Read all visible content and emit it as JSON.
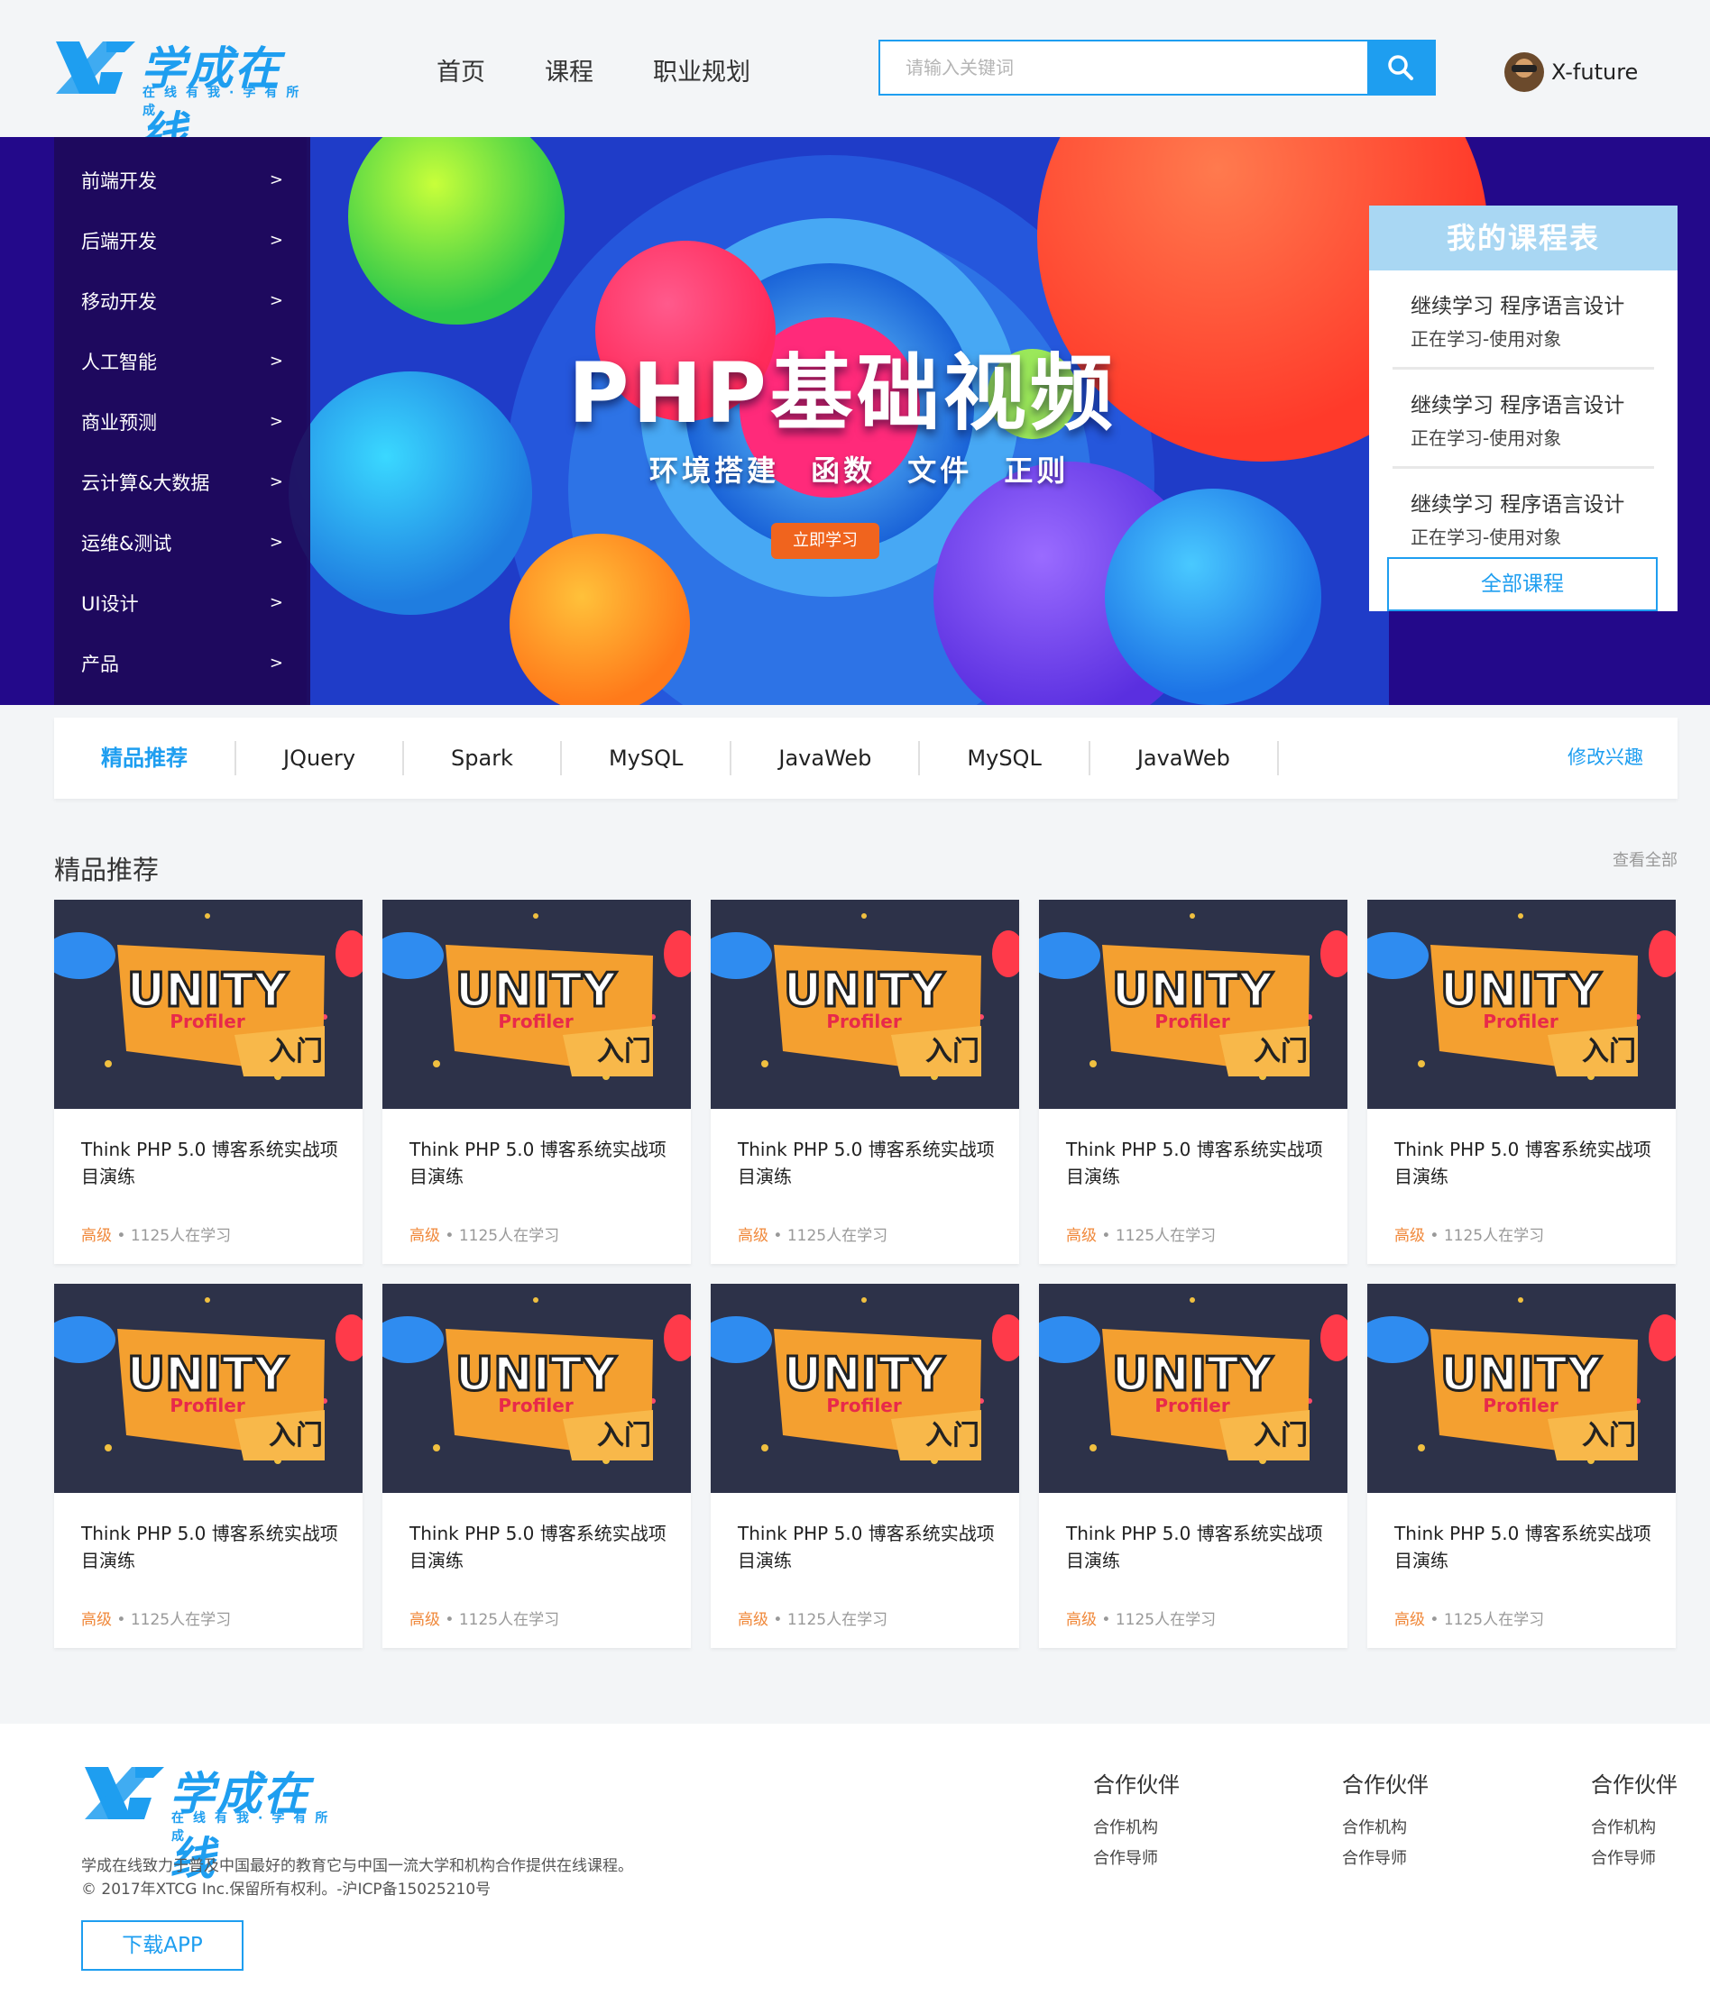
{
  "header": {
    "logo_text": "学成在线",
    "logo_sub": "在线有我·学有所成",
    "nav": [
      "首页",
      "课程",
      "职业规划"
    ],
    "search_placeholder": "请输入关键词",
    "user_name": "X-future"
  },
  "banner": {
    "title": "PHP基础视频",
    "subtitle": "环境搭建 函数 文件 正则",
    "button": "立即学习"
  },
  "categories": [
    {
      "label": "前端开发",
      "arrow": ">"
    },
    {
      "label": "后端开发",
      "arrow": ">"
    },
    {
      "label": "移动开发",
      "arrow": ">"
    },
    {
      "label": "人工智能",
      "arrow": ">"
    },
    {
      "label": "商业预测",
      "arrow": ">"
    },
    {
      "label": "云计算&大数据",
      "arrow": ">"
    },
    {
      "label": "运维&测试",
      "arrow": ">"
    },
    {
      "label": "UI设计",
      "arrow": ">"
    },
    {
      "label": "产品",
      "arrow": ">"
    }
  ],
  "schedule": {
    "title": "我的课程表",
    "items": [
      {
        "course": "继续学习 程序语言设计",
        "status": "正在学习-使用对象"
      },
      {
        "course": "继续学习 程序语言设计",
        "status": "正在学习-使用对象"
      },
      {
        "course": "继续学习 程序语言设计",
        "status": "正在学习-使用对象"
      }
    ],
    "all_button": "全部课程"
  },
  "tabs": {
    "items": [
      "精品推荐",
      "JQuery",
      "Spark",
      "MySQL",
      "JavaWeb",
      "MySQL",
      "JavaWeb"
    ],
    "edit": "修改兴趣"
  },
  "section": {
    "title": "精品推荐",
    "more": "查看全部"
  },
  "courses": [
    {
      "title": "Think PHP 5.0 博客系统实战项目演练",
      "level": "高级",
      "sep": "•",
      "learners": "1125人在学习"
    },
    {
      "title": "Think PHP 5.0 博客系统实战项目演练",
      "level": "高级",
      "sep": "•",
      "learners": "1125人在学习"
    },
    {
      "title": "Think PHP 5.0 博客系统实战项目演练",
      "level": "高级",
      "sep": "•",
      "learners": "1125人在学习"
    },
    {
      "title": "Think PHP 5.0 博客系统实战项目演练",
      "level": "高级",
      "sep": "•",
      "learners": "1125人在学习"
    },
    {
      "title": "Think PHP 5.0 博客系统实战项目演练",
      "level": "高级",
      "sep": "•",
      "learners": "1125人在学习"
    },
    {
      "title": "Think PHP 5.0 博客系统实战项目演练",
      "level": "高级",
      "sep": "•",
      "learners": "1125人在学习"
    },
    {
      "title": "Think PHP 5.0 博客系统实战项目演练",
      "level": "高级",
      "sep": "•",
      "learners": "1125人在学习"
    },
    {
      "title": "Think PHP 5.0 博客系统实战项目演练",
      "level": "高级",
      "sep": "•",
      "learners": "1125人在学习"
    },
    {
      "title": "Think PHP 5.0 博客系统实战项目演练",
      "level": "高级",
      "sep": "•",
      "learners": "1125人在学习"
    },
    {
      "title": "Think PHP 5.0 博客系统实战项目演练",
      "level": "高级",
      "sep": "•",
      "learners": "1125人在学习"
    }
  ],
  "thumb": {
    "word": "UNITY",
    "tag": "Profiler",
    "sub": "入门"
  },
  "footer": {
    "logo_text": "学成在线",
    "logo_sub": "在线有我·学有所成",
    "desc_line1": "学成在线致力于普及中国最好的教育它与中国一流大学和机构合作提供在线课程。",
    "desc_line2": "© 2017年XTCG Inc.保留所有权利。-沪ICP备15025210号",
    "download": "下载APP",
    "columns": [
      {
        "heading": "合作伙伴",
        "links": [
          "合作机构",
          "合作导师"
        ]
      },
      {
        "heading": "合作伙伴",
        "links": [
          "合作机构",
          "合作导师"
        ]
      },
      {
        "heading": "合作伙伴",
        "links": [
          "合作机构",
          "合作导师"
        ]
      }
    ]
  },
  "colors": {
    "brand": "#1e9ef0",
    "banner_bg": "#2a0b8a",
    "level": "#f0883a",
    "schedule_head": "#a9d7f3"
  }
}
